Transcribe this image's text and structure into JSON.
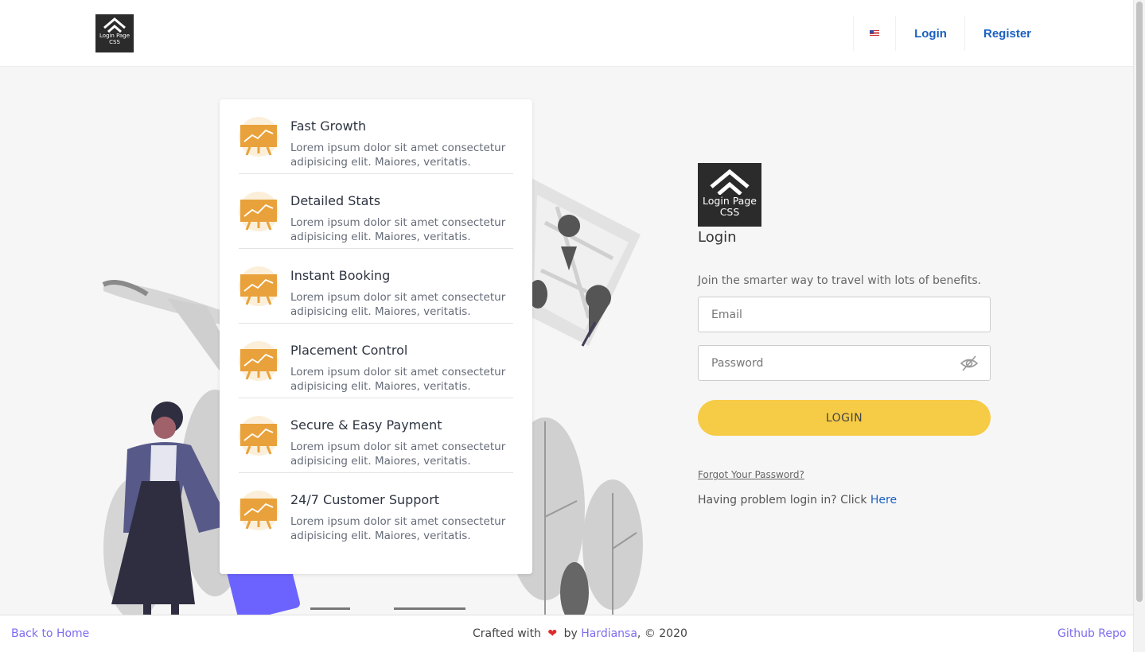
{
  "header": {
    "logo_text": "Login Page CSS",
    "nav": {
      "flag_icon": "us-flag-icon",
      "login": "Login",
      "register": "Register"
    }
  },
  "features": [
    {
      "title": "Fast Growth",
      "description": "Lorem ipsum dolor sit amet consectetur adipisicing elit. Maiores, veritatis."
    },
    {
      "title": "Detailed Stats",
      "description": "Lorem ipsum dolor sit amet consectetur adipisicing elit. Maiores, veritatis."
    },
    {
      "title": "Instant Booking",
      "description": "Lorem ipsum dolor sit amet consectetur adipisicing elit. Maiores, veritatis."
    },
    {
      "title": "Placement Control",
      "description": "Lorem ipsum dolor sit amet consectetur adipisicing elit. Maiores, veritatis."
    },
    {
      "title": "Secure & Easy Payment",
      "description": "Lorem ipsum dolor sit amet consectetur adipisicing elit. Maiores, veritatis."
    },
    {
      "title": "24/7 Customer Support",
      "description": "Lorem ipsum dolor sit amet consectetur adipisicing elit. Maiores, veritatis."
    }
  ],
  "login": {
    "logo_text": "Login Page CSS",
    "heading": "Login",
    "subtitle": "Join the smarter way to travel with lots of benefits.",
    "email_placeholder": "Email",
    "password_placeholder": "Password",
    "button": "LOGIN",
    "forgot": "Forgot Your Password?",
    "problem_text": "Having problem login in? Click ",
    "problem_link": "Here"
  },
  "footer": {
    "back_home": "Back to Home",
    "crafted": "Crafted with",
    "heart": "❤",
    "by": "by",
    "author": "Hardiansa",
    "copyright": ", © 2020",
    "github": "Github Repo"
  },
  "colors": {
    "accent_blue": "#1b60c2",
    "button_yellow": "#f6cb45",
    "feature_orange": "#e9a23b",
    "footer_link": "#7c6df0"
  }
}
